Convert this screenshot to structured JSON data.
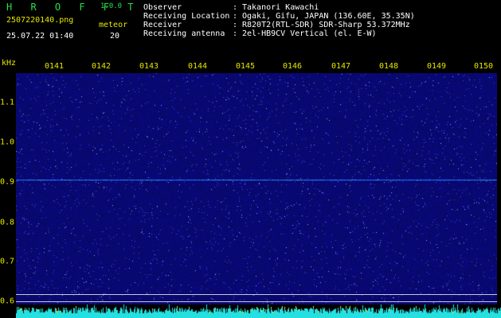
{
  "header": {
    "brand": "H R O F F T",
    "version": "1.0.0",
    "filename": "2507220140.png",
    "timestamp": "25.07.22 01:40",
    "meteor_label": "meteor",
    "meteor_count": "20"
  },
  "info": [
    {
      "key": "Observer",
      "sep": ":",
      "value": "Takanori Kawachi"
    },
    {
      "key": "Receiving Location",
      "sep": ":",
      "value": "Ogaki, Gifu, JAPAN (136.60E, 35.35N)"
    },
    {
      "key": "Receiver",
      "sep": ":",
      "value": "R820T2(RTL-SDR) SDR-Sharp 53.372MHz"
    },
    {
      "key": "Receiving antenna",
      "sep": ":",
      "value": "2el-HB9CV Vertical (el. E-W)"
    }
  ],
  "plot": {
    "unit_label": "kHz",
    "time_ticks": [
      "0141",
      "0142",
      "0143",
      "0144",
      "0145",
      "0146",
      "0147",
      "0148",
      "0149",
      "0150"
    ],
    "freq_ticks": [
      "1.1",
      "1.0",
      "0.9",
      "0.8",
      "0.7",
      "0.6"
    ]
  },
  "colors": {
    "brand": "#25e04a",
    "label": "#e6e600",
    "text": "#ffffff",
    "waterfall_bg": "#0f0f7a",
    "spectrum": "#25e0e0"
  }
}
